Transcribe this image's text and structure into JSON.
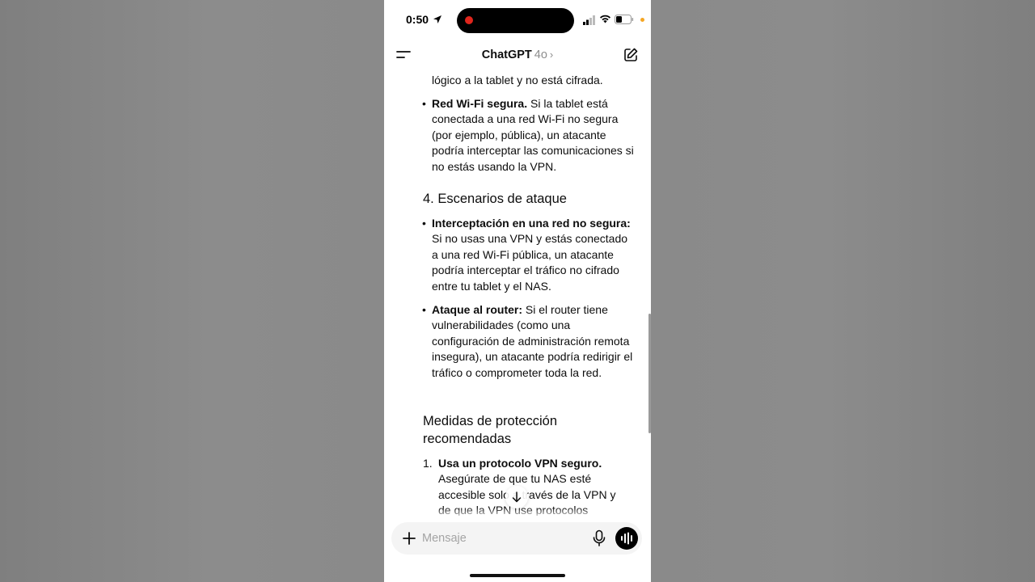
{
  "status_bar": {
    "time": "0:50"
  },
  "header": {
    "app_name": "ChatGPT",
    "model": "4o",
    "chevron": "›"
  },
  "content": {
    "intro_line": "lógico a la tablet y no está cifrada.",
    "bullet_wifi": {
      "bold": "Red Wi-Fi segura.",
      "text": " Si la tablet está conectada a una red Wi-Fi no segura (por ejemplo, pública), un atacante podría interceptar las comunicaciones si no estás usando la VPN."
    },
    "section4_title": "4. Escenarios de ataque",
    "bullet_interception": {
      "bold": "Interceptación en una red no segura:",
      "text": " Si no usas una VPN y estás conectado a una red Wi-Fi pública, un atacante podría interceptar el tráfico no cifrado entre tu tablet y el NAS."
    },
    "bullet_router": {
      "bold": "Ataque al router:",
      "text": " Si el router tiene vulnerabilidades (como una configuración de administración remota insegura), un atacante podría redirigir el tráfico o comprometer toda la red."
    },
    "protection_title": "Medidas de protección recomendadas",
    "item1": {
      "number": "1.",
      "bold": "Usa un protocolo VPN seguro.",
      "text": " Asegúrate de que tu NAS esté accesible solo a través de la VPN y de que la VPN use protocolos"
    },
    "bullet_char": "•"
  },
  "composer": {
    "placeholder": "Mensaje"
  },
  "icons": {
    "menu": "menu-icon",
    "edit": "new-chat-icon",
    "plus": "plus-icon",
    "mic": "microphone-icon",
    "voice": "voice-mode-icon",
    "scroll_down": "arrow-down-icon"
  },
  "colors": {
    "accent": "#000000",
    "recording": "#e0251c",
    "privacy_dot": "#f5a623"
  }
}
